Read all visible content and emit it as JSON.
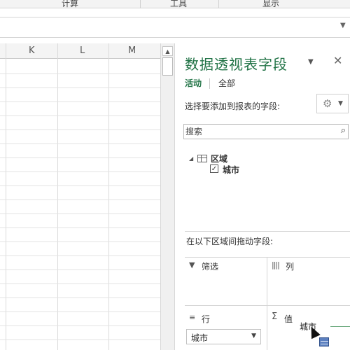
{
  "ribbon": {
    "groups": [
      "计算",
      "工具",
      "显示"
    ]
  },
  "formula_bar": {
    "expand_icon": "chevron-down-icon"
  },
  "sheet": {
    "columns": [
      "K",
      "L",
      "M"
    ]
  },
  "pane": {
    "title": "数据透视表字段",
    "tabs": [
      "活动",
      "全部"
    ],
    "choose_fields_label": "选择要添加到报表的字段:",
    "search_placeholder": "搜索",
    "tree": {
      "table_name": "区域",
      "fields": [
        {
          "label": "城市",
          "checked": true
        }
      ]
    },
    "drag_label": "在以下区域间拖动字段:",
    "areas": {
      "filters": "筛选",
      "columns": "列",
      "rows": "行",
      "values": "值",
      "rows_field": "城市"
    },
    "drag_ghost_text": "城市",
    "accent_color": "#217346"
  }
}
